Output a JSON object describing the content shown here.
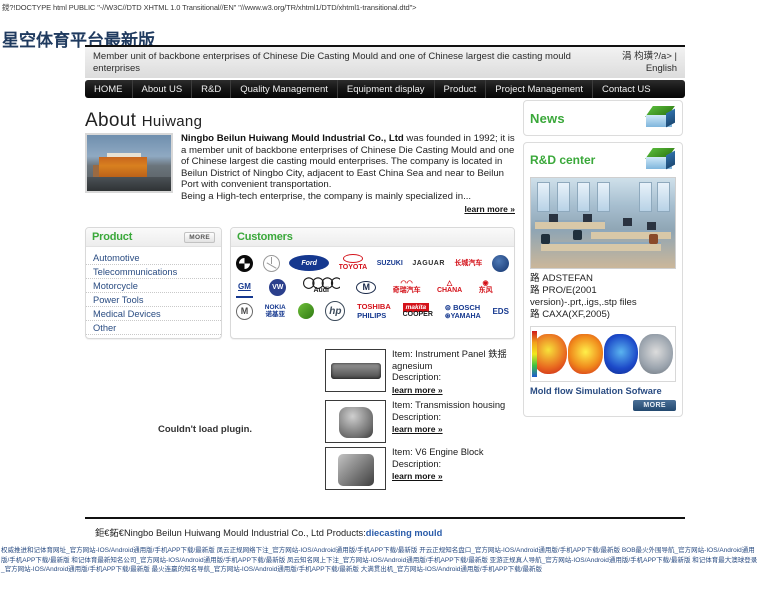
{
  "doctype_line": "鎲?!DOCTYPE html PUBLIC \"-//W3C//DTD XHTML 1.0 Transitional//EN\" \"//www.w3.org/TR/xhtml1/DTD/xhtml1-transitional.dtd\">",
  "site_title": "星空体育平台最新版",
  "topbar": {
    "slogan": "Member unit of backbone enterprises of Chinese Die Casting Mould and one of Chinese largest die casting mould enterprises",
    "lang_cn": "涓 枃璜?/a> |",
    "lang_en": "English"
  },
  "nav": {
    "items": [
      {
        "label": "HOME",
        "name": "nav-home"
      },
      {
        "label": "About US",
        "name": "nav-about-us"
      },
      {
        "label": "R&D",
        "name": "nav-rd"
      },
      {
        "label": "Quality Management",
        "name": "nav-quality-management"
      },
      {
        "label": "Equipment display",
        "name": "nav-equipment-display"
      },
      {
        "label": "Product",
        "name": "nav-product"
      },
      {
        "label": "Project Management",
        "name": "nav-project-management"
      },
      {
        "label": "Contact US",
        "name": "nav-contact-us"
      }
    ]
  },
  "about": {
    "heading_main": "About",
    "heading_sub": "Huiwang",
    "company_bold": "Ningbo Beilun Huiwang Mould Industrial Co., Ltd",
    "body": " was founded in 1992; it is a member unit of backbone enterprises of Chinese Die Casting Mould and one of Chinese largest die casting mould enterprises. The company is located in Beilun District of Ningbo City, adjacent to East China Sea and near to Beilun Port with convenient transportation.",
    "body2": "Being a High-tech enterprise, the company is mainly specialized in...",
    "learn_more": "learn more »"
  },
  "product_panel": {
    "title": "Product",
    "more_label": "MORE",
    "items": [
      "Automotive",
      "Telecommunications",
      "Motorcycle",
      "Power Tools",
      "Medical Devices",
      "Other"
    ]
  },
  "customers_panel": {
    "title": "Customers",
    "row1": [
      "BMW",
      "Mercedes-Benz",
      "Ford",
      "TOYOTA",
      "SUZUKI",
      "JAGUAR",
      "长城汽车",
      "Brilliance"
    ],
    "row2": [
      "GM",
      "Volkswagen",
      "Audi",
      "MAZDA",
      "奇瑞汽车",
      "Changan",
      "东风"
    ],
    "row3": [
      "Motorola",
      "NOKIA 诺基亚",
      "Sony Ericsson",
      "hp invent",
      "TOSHIBA",
      "makita",
      "BOSCH",
      "EDS",
      "PHILIPS",
      "COOPER",
      "YAMAHA"
    ]
  },
  "news_panel": {
    "title": "News",
    "icon": "cube-icon"
  },
  "rd_panel": {
    "title": "R&D center",
    "icon": "cube-icon",
    "software": [
      "路 ADSTEFAN",
      "路 PRO/E(2001 version)-.prt,.igs,.stp files",
      "路 CAXA(XF,2005)"
    ],
    "flow_caption": "Mold flow Simulation Sofware",
    "more_label": "MORE"
  },
  "plugin": {
    "message": "Couldn't load plugin."
  },
  "items": [
    {
      "title": "Item: Instrument Panel 鉄揺agnesium",
      "description": "Description:",
      "learn_more": "learn more »",
      "thumb": "instrument-panel-thumb"
    },
    {
      "title": "Item: Transmission housing",
      "description": "Description:",
      "learn_more": "learn more »",
      "thumb": "transmission-housing-thumb"
    },
    {
      "title": "Item: V6 Engine Block",
      "description": "Description:",
      "learn_more": "learn more »",
      "thumb": "v6-engine-block-thumb"
    }
  ],
  "footer": {
    "prefix": "鉅€鉐€",
    "text": "Ningbo Beilun Huiwang Mould Industrial Co., Ltd Products:",
    "link": "diecasting mould"
  },
  "spam_text": "权威推进和记体育网址_官方网站-IOS/Android通用版/手机APP下载/最新版 凤云正规网络下注_官方网站-IOS/Android通用版/手机APP下载/最新版 开云正规知名盘口_官方网站-IOS/Android通用版/手机APP下载/最新版 BOB最火外围导航_官方网站-IOS/Android通用版/手机APP下载/最新版 和记体育最新知名公司_官方网站-IOS/Android通用版/手机APP下载/最新版 凤云知名网上下注_官方网站-IOS/Android通用版/手机APP下载/最新版 亚游正规真人导航_官方网站-IOS/Android通用版/手机APP下载/最新版 和记体育最大澳球登录_官方网站-IOS/Android通用版/手机APP下载/最新版 最火连赢的知名导航_官方网站-IOS/Android通用版/手机APP下载/最新版 大满贯出机_官方网站-IOS/Android通用版/手机APP下载/最新版",
  "colors": {
    "accent_green": "#3aa83a",
    "link_blue": "#2a4c82",
    "nav_bg": "#101010",
    "title_navy": "#1f3a5f"
  }
}
